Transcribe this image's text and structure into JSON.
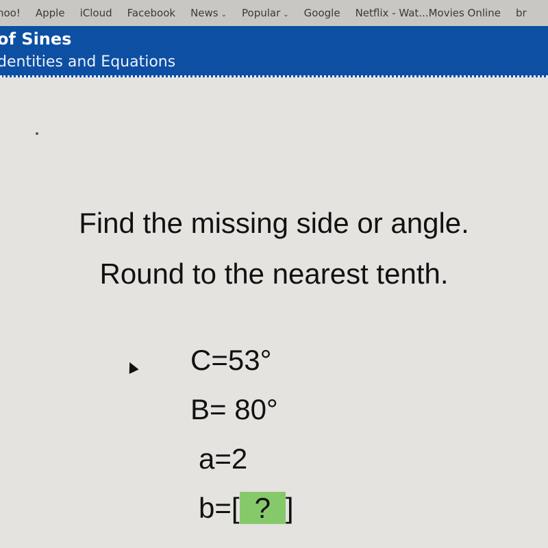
{
  "bookmarks": [
    {
      "label": "hoo!"
    },
    {
      "label": "Apple"
    },
    {
      "label": "iCloud"
    },
    {
      "label": "Facebook"
    },
    {
      "label": "News",
      "dropdown": true
    },
    {
      "label": "Popular",
      "dropdown": true
    },
    {
      "label": "Google"
    },
    {
      "label": "Netflix - Wat...Movies Online"
    },
    {
      "label": "br"
    }
  ],
  "header": {
    "title": "of Sines",
    "subtitle": "dentities and Equations",
    "color": "#0d4fa3"
  },
  "question": {
    "line1": "Find the missing side or angle.",
    "line2": "Round to the nearest tenth.",
    "givens": [
      "C=53°",
      "B= 80°",
      "a=2"
    ],
    "answer_prefix": "b=[",
    "answer_value": "?",
    "answer_suffix": "]",
    "answer_color": "#86c96a"
  }
}
